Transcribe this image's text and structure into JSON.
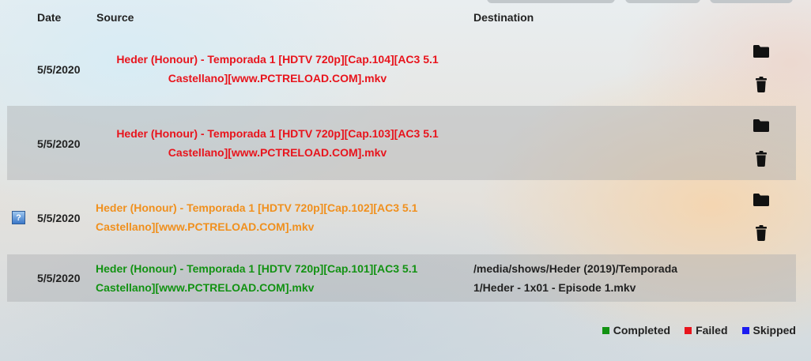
{
  "header": {
    "date": "Date",
    "source": "Source",
    "destination": "Destination"
  },
  "rows": [
    {
      "date": "5/5/2020",
      "source_line1": "Heder (Honour) - Temporada 1 [HDTV 720p][Cap.104][AC3 5.1",
      "source_line2": "Castellano][www.PCTRELOAD.COM].mkv",
      "status": "failed",
      "destination_line1": "",
      "destination_line2": ""
    },
    {
      "date": "5/5/2020",
      "source_line1": "Heder (Honour) - Temporada 1 [HDTV 720p][Cap.103][AC3 5.1",
      "source_line2": "Castellano][www.PCTRELOAD.COM].mkv",
      "status": "failed",
      "destination_line1": "",
      "destination_line2": ""
    },
    {
      "date": "5/5/2020",
      "source_line1": "Heder (Honour) - Temporada 1 [HDTV 720p][Cap.102][AC3 5.1",
      "source_line2": "Castellano][www.PCTRELOAD.COM].mkv",
      "status": "pending",
      "help_icon": "?",
      "destination_line1": "",
      "destination_line2": ""
    },
    {
      "date": "5/5/2020",
      "source_line1": "Heder (Honour) - Temporada 1 [HDTV 720p][Cap.101][AC3 5.1",
      "source_line2": "Castellano][www.PCTRELOAD.COM].mkv",
      "status": "completed",
      "destination_line1": "/media/shows/Heder (2019)/Temporada",
      "destination_line2": "1/Heder - 1x01 - Episode 1.mkv"
    }
  ],
  "colors": {
    "failed": "#e8141c",
    "pending": "#f0901e",
    "completed": "#129212",
    "skipped": "#1c1cf0"
  },
  "icons": {
    "folder": "folder-icon",
    "delete": "trash-icon",
    "help": "help-icon"
  },
  "legend": {
    "completed": "Completed",
    "failed": "Failed",
    "skipped": "Skipped"
  }
}
